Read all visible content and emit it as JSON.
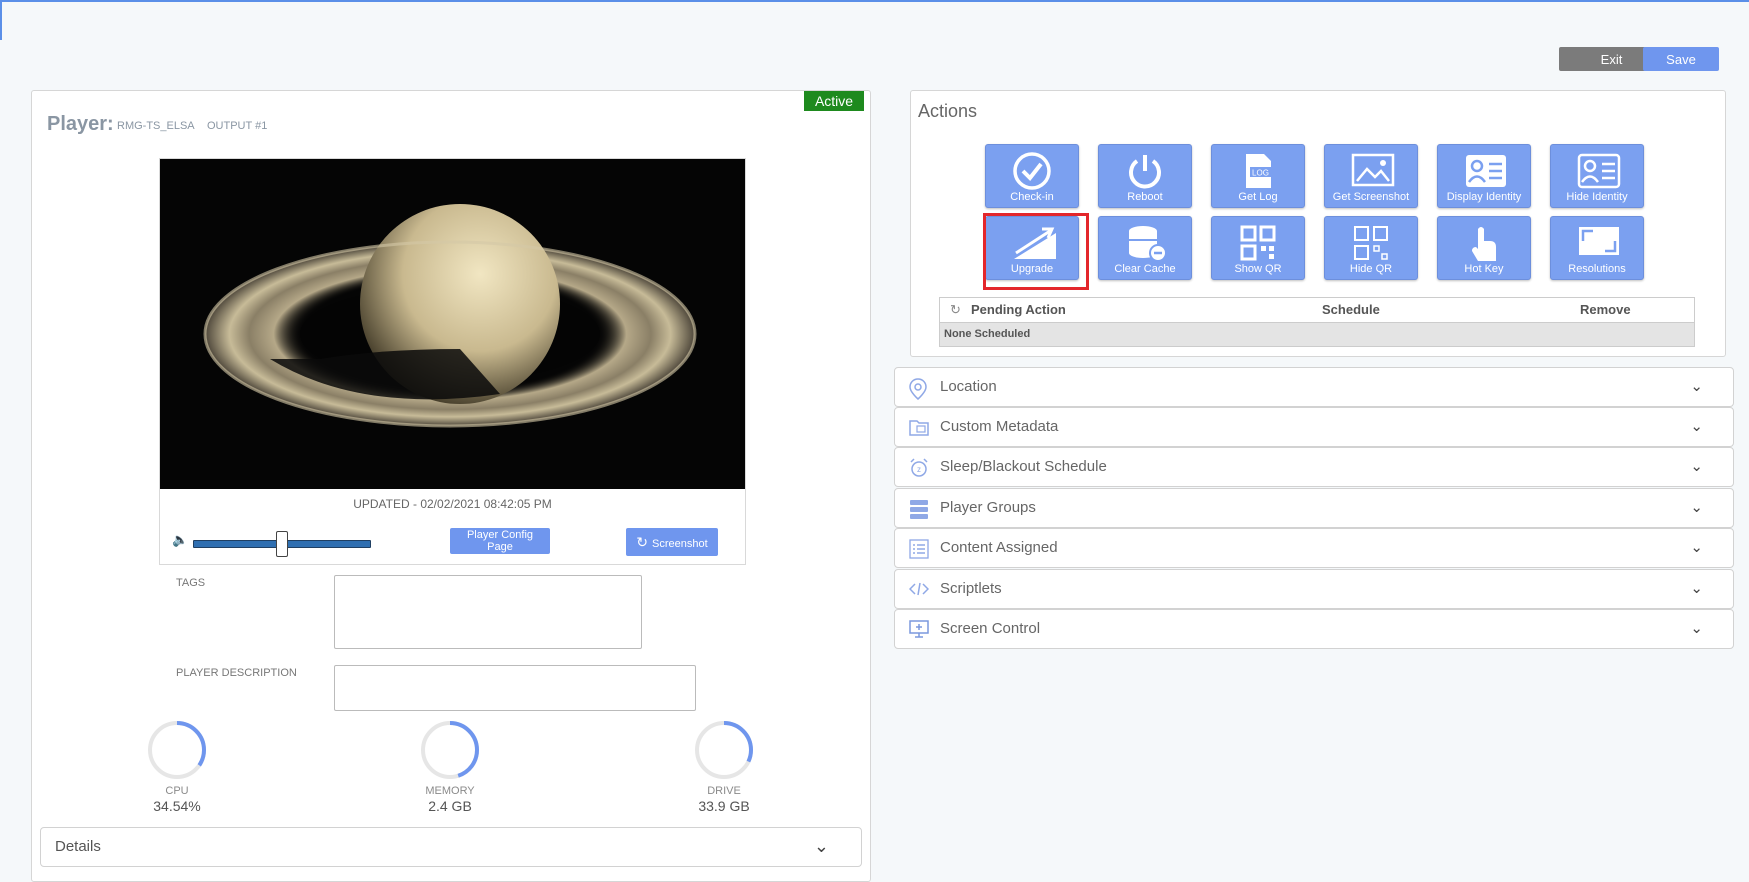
{
  "header": {
    "exit_label": "Exit",
    "save_label": "Save"
  },
  "player": {
    "title": "Player:",
    "name": "RMG-TS_ELSA",
    "output": "OUTPUT #1",
    "status": "Active",
    "updated": "UPDATED - 02/02/2021 08:42:05 PM",
    "volume": 0.5,
    "config_button": "Player Config Page",
    "screenshot_button": "Screenshot",
    "tags_label": "TAGS",
    "description_label": "PLAYER DESCRIPTION",
    "tags_value": "",
    "description_value": ""
  },
  "stats": [
    {
      "label": "CPU",
      "value": "34.54%",
      "fraction": 0.3454
    },
    {
      "label": "MEMORY",
      "value": "2.4 GB",
      "fraction": 0.45
    },
    {
      "label": "DRIVE",
      "value": "33.9 GB",
      "fraction": 0.32
    }
  ],
  "details": {
    "label": "Details"
  },
  "actions": {
    "title": "Actions",
    "buttons": [
      {
        "label": "Check-in",
        "icon": "check-circle-icon"
      },
      {
        "label": "Reboot",
        "icon": "power-icon"
      },
      {
        "label": "Get Log",
        "icon": "log-file-icon"
      },
      {
        "label": "Get Screenshot",
        "icon": "image-icon"
      },
      {
        "label": "Display Identity",
        "icon": "id-card-icon"
      },
      {
        "label": "Hide Identity",
        "icon": "id-card-outline-icon"
      },
      {
        "label": "Upgrade",
        "icon": "upgrade-arrow-icon"
      },
      {
        "label": "Clear Cache",
        "icon": "database-minus-icon"
      },
      {
        "label": "Show QR",
        "icon": "qr-code-icon"
      },
      {
        "label": "Hide QR",
        "icon": "qr-code-outline-icon"
      },
      {
        "label": "Hot Key",
        "icon": "pointer-hand-icon"
      },
      {
        "label": "Resolutions",
        "icon": "resize-icon"
      }
    ],
    "table": {
      "headers": [
        "Pending Action",
        "Schedule",
        "Remove"
      ],
      "empty": "None Scheduled"
    }
  },
  "sections": [
    {
      "label": "Location",
      "icon": "map-pin-icon"
    },
    {
      "label": "Custom Metadata",
      "icon": "folder-image-icon"
    },
    {
      "label": "Sleep/Blackout Schedule",
      "icon": "alarm-clock-icon"
    },
    {
      "label": "Player Groups",
      "icon": "server-stack-icon"
    },
    {
      "label": "Content Assigned",
      "icon": "list-icon"
    },
    {
      "label": "Scriptlets",
      "icon": "code-icon"
    },
    {
      "label": "Screen Control",
      "icon": "monitor-icon"
    }
  ],
  "colors": {
    "accent": "#6f96ee",
    "active": "#1e8a1e",
    "highlight": "#e3262b"
  }
}
